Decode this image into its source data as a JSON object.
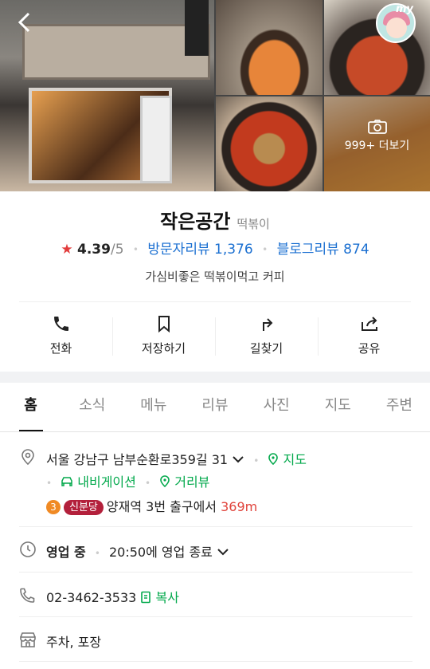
{
  "photos": {
    "more_label": "999+ 더보기",
    "my_label": "my"
  },
  "place": {
    "name": "작은공간",
    "category": "떡볶이",
    "rating": "4.39",
    "rating_max": "/5",
    "visitor_reviews": "방문자리뷰 1,376",
    "blog_reviews": "블로그리뷰 874",
    "description": "가심비좋은 떡볶이먹고 커피"
  },
  "actions": [
    {
      "label": "전화",
      "icon": "phone-icon"
    },
    {
      "label": "저장하기",
      "icon": "bookmark-icon"
    },
    {
      "label": "길찾기",
      "icon": "directions-icon"
    },
    {
      "label": "공유",
      "icon": "share-icon"
    }
  ],
  "tabs": [
    "홈",
    "소식",
    "메뉴",
    "리뷰",
    "사진",
    "지도",
    "주변"
  ],
  "info": {
    "address": "서울 강남구 남부순환로359길 31",
    "map_link": "지도",
    "navigation_link": "내비게이션",
    "streetview_link": "거리뷰",
    "subway_line_number": "3",
    "subway_line_name": "신분당",
    "station": "양재역",
    "exit_text": "3번 출구에서",
    "distance": "369m",
    "status": "영업 중",
    "hours": "20:50에 영업 종료",
    "phone": "02-3462-3533",
    "copy_label": "복사",
    "amenities": "주차, 포장"
  },
  "colors": {
    "accent_green": "#03a94c",
    "link_blue": "#1a6fd1",
    "star_red": "#e23c3c",
    "line_badge": "#b3203b"
  }
}
